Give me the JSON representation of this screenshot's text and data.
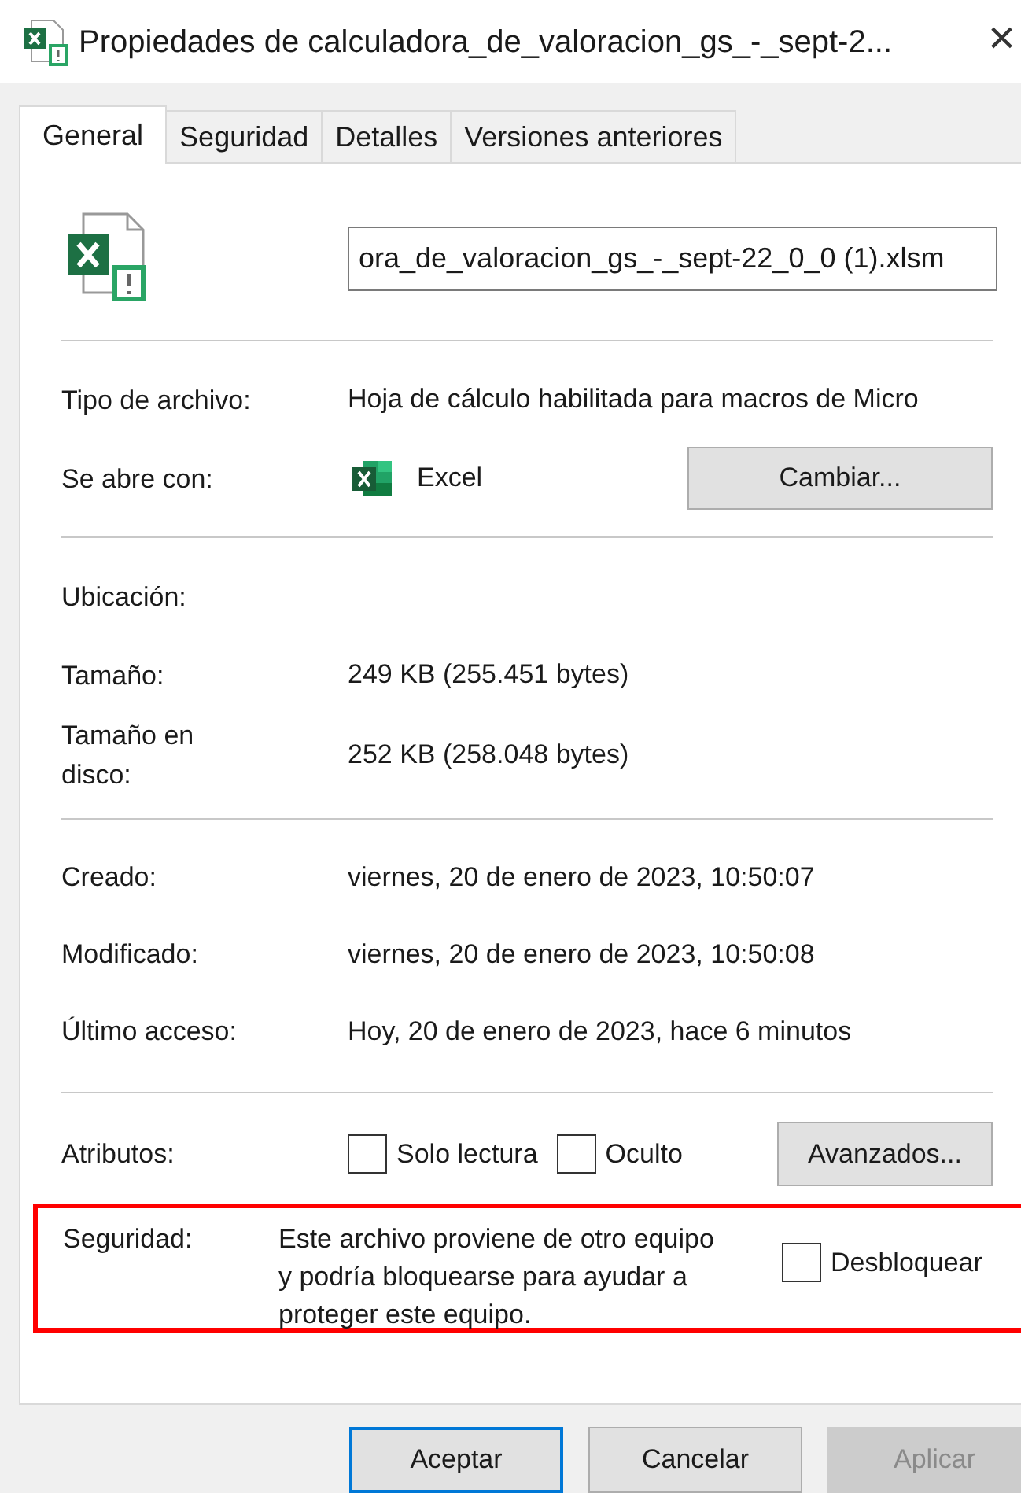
{
  "window": {
    "title": "Propiedades de calculadora_de_valoracion_gs_-_sept-2...",
    "close": "×"
  },
  "tabs": [
    {
      "label": "General",
      "selected": true
    },
    {
      "label": "Seguridad",
      "selected": false
    },
    {
      "label": "Detalles",
      "selected": false
    },
    {
      "label": "Versiones anteriores",
      "selected": false
    }
  ],
  "file_name": "ora_de_valoracion_gs_-_sept-22_0_0 (1).xlsm",
  "type": {
    "label": "Tipo de archivo:",
    "value": "Hoja de cálculo habilitada para macros de Micro"
  },
  "opens_with": {
    "label": "Se abre con:",
    "app": "Excel",
    "button": "Cambiar..."
  },
  "location": {
    "label": "Ubicación:"
  },
  "size": {
    "label": "Tamaño:",
    "value": "249 KB (255.451 bytes)"
  },
  "size_on_disk": {
    "label": "Tamaño en disco:",
    "value": "252 KB (258.048 bytes)"
  },
  "dates": [
    {
      "label": "Creado:",
      "value": "viernes, 20 de enero de 2023, 10:50:07"
    },
    {
      "label": "Modificado:",
      "value": "viernes, 20 de enero de 2023, 10:50:08"
    },
    {
      "label": "Último acceso:",
      "value": "Hoy, 20 de enero de 2023, hace 6 minutos"
    }
  ],
  "attributes": {
    "label": "Atributos:",
    "options": [
      {
        "label": "Solo lectura",
        "checked": false
      },
      {
        "label": "Oculto",
        "checked": false
      }
    ],
    "button": "Avanzados..."
  },
  "security": {
    "label": "Seguridad:",
    "text": "Este archivo proviene de otro equipo y podría bloquearse para ayudar a proteger este equipo.",
    "unblock": {
      "label": "Desbloquear",
      "checked": false
    },
    "highlighted": true
  },
  "buttons": [
    {
      "label": "Aceptar",
      "kind": "default"
    },
    {
      "label": "Cancelar",
      "kind": "normal"
    },
    {
      "label": "Aplicar",
      "kind": "disabled"
    }
  ]
}
